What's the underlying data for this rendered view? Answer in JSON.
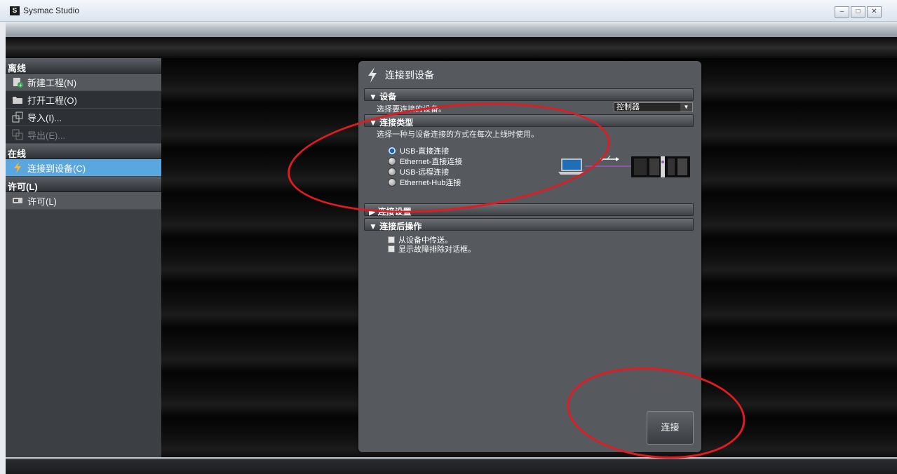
{
  "window": {
    "app_icon": "S",
    "title": "Sysmac Studio",
    "buttons": [
      "–",
      "□",
      "✕"
    ]
  },
  "sidebar": {
    "offline_header": "离线",
    "new_project": "新建工程(N)",
    "open_project": "打开工程(O)",
    "import": "导入(I)...",
    "export": "导出(E)...",
    "online_header": "在线",
    "connect_device": "连接到设备(C)",
    "license_header": "许可(L)",
    "license_item": "许可(L)"
  },
  "dialog": {
    "title": "连接到设备",
    "device_section": "▼ 设备",
    "device_desc": "选择要连接的设备。",
    "device_select_value": "控制器",
    "conn_type_section": "▼ 连接类型",
    "conn_type_desc": "选择一种与设备连接的方式在每次上线时使用。",
    "conn_options": [
      "USB-直接连接",
      "Ethernet-直接连接",
      "USB-远程连接",
      "Ethernet-Hub连接"
    ],
    "selected_option": "USB-直接连接",
    "conn_settings_section": "▶ 连接设置",
    "after_conn_section": "▼ 连接后操作",
    "after_conn_options": [
      "从设备中传送。",
      "显示故障排除对话框。"
    ],
    "connect_button": "连接"
  },
  "colors": {
    "active_nav": "#5aa7df",
    "annotation": "#e11b22",
    "accent_icon": "#f7b731"
  }
}
